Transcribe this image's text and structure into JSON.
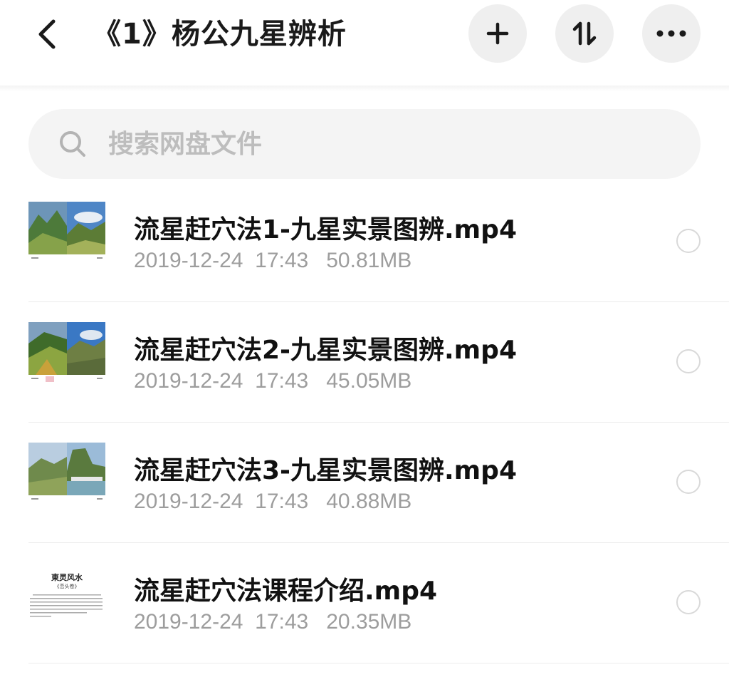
{
  "header": {
    "title": "《1》杨公九星辨析",
    "back_icon": "chevron-left-icon",
    "add_icon": "plus-icon",
    "sort_icon": "sort-arrows-icon",
    "more_icon": "more-dots-icon"
  },
  "search": {
    "placeholder": "搜索网盘文件",
    "value": ""
  },
  "files": [
    {
      "name": "流星赶穴法1-九星实景图辨.mp4",
      "date": "2019-12-24",
      "time": "17:43",
      "size": "50.81MB",
      "thumbnail": "landscape-thumbnail"
    },
    {
      "name": "流星赶穴法2-九星实景图辨.mp4",
      "date": "2019-12-24",
      "time": "17:43",
      "size": "45.05MB",
      "thumbnail": "landscape-thumbnail"
    },
    {
      "name": "流星赶穴法3-九星实景图辨.mp4",
      "date": "2019-12-24",
      "time": "17:43",
      "size": "40.88MB",
      "thumbnail": "landscape-thumbnail"
    },
    {
      "name": "流星赶穴法课程介绍.mp4",
      "date": "2019-12-24",
      "time": "17:43",
      "size": "20.35MB",
      "thumbnail": "document-thumbnail",
      "thumbnail_title": "東灵风水",
      "thumbnail_subtitle": "《峦头卷》"
    }
  ],
  "colors": {
    "accent_bg": "#efefef",
    "meta_text": "#9d9d9d",
    "placeholder": "#bdbdbd"
  }
}
